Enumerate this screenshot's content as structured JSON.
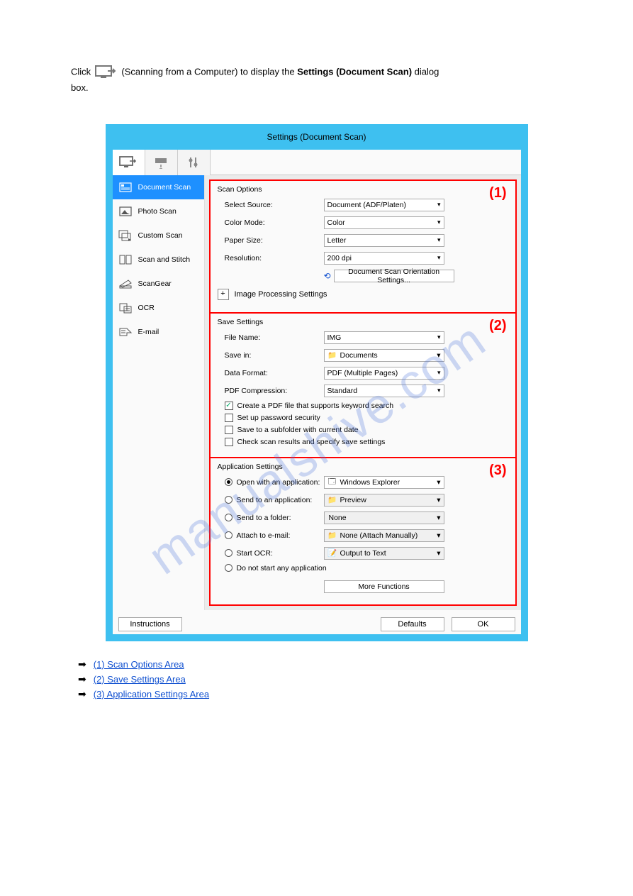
{
  "preamble": {
    "line1_prefix": "Click ",
    "line1_tab": " (Scanning from a Computer) to display the ",
    "line1_dlg": "Settings (Document Scan)",
    "line1_end": " dialog",
    "line2": "box."
  },
  "dialog": {
    "title": "Settings (Document Scan)"
  },
  "sidebar_items": [
    {
      "label": "Document Scan"
    },
    {
      "label": "Photo Scan"
    },
    {
      "label": "Custom Scan"
    },
    {
      "label": "Scan and Stitch"
    },
    {
      "label": "ScanGear"
    },
    {
      "label": "OCR"
    },
    {
      "label": "E-mail"
    }
  ],
  "scan_options": {
    "title": "Scan Options",
    "section_num": "(1)",
    "select_source_label": "Select Source:",
    "select_source_value": "Document (ADF/Platen)",
    "color_mode_label": "Color Mode:",
    "color_mode_value": "Color",
    "paper_size_label": "Paper Size:",
    "paper_size_value": "Letter",
    "resolution_label": "Resolution:",
    "resolution_value": "200 dpi",
    "orient_button": "Document Scan Orientation Settings...",
    "ip_settings": "Image Processing Settings"
  },
  "save_settings": {
    "title": "Save Settings",
    "section_num": "(2)",
    "file_name_label": "File Name:",
    "file_name_value": "IMG",
    "save_in_label": "Save in:",
    "save_in_value": "Documents",
    "data_format_label": "Data Format:",
    "data_format_value": "PDF (Multiple Pages)",
    "pdf_comp_label": "PDF Compression:",
    "pdf_comp_value": "Standard",
    "cb_keyword": "Create a PDF file that supports keyword search",
    "cb_password": "Set up password security",
    "cb_subfolder": "Save to a subfolder with current date",
    "cb_checkresults": "Check scan results and specify save settings"
  },
  "app_settings": {
    "title": "Application Settings",
    "section_num": "(3)",
    "open_app_label": "Open with an application:",
    "open_app_value": "Windows Explorer",
    "send_app_label": "Send to an application:",
    "send_app_value": "Preview",
    "send_folder_label": "Send to a folder:",
    "send_folder_value": "None",
    "attach_email_label": "Attach to e-mail:",
    "attach_email_value": "None (Attach Manually)",
    "start_ocr_label": "Start OCR:",
    "start_ocr_value": "Output to Text",
    "do_not_start_label": "Do not start any application",
    "more_functions": "More Functions"
  },
  "footer": {
    "instructions": "Instructions",
    "defaults": "Defaults",
    "ok": "OK"
  },
  "links": [
    "(1) Scan Options Area",
    "(2) Save Settings Area",
    "(3) Application Settings Area"
  ],
  "watermark": "manualshive.com"
}
